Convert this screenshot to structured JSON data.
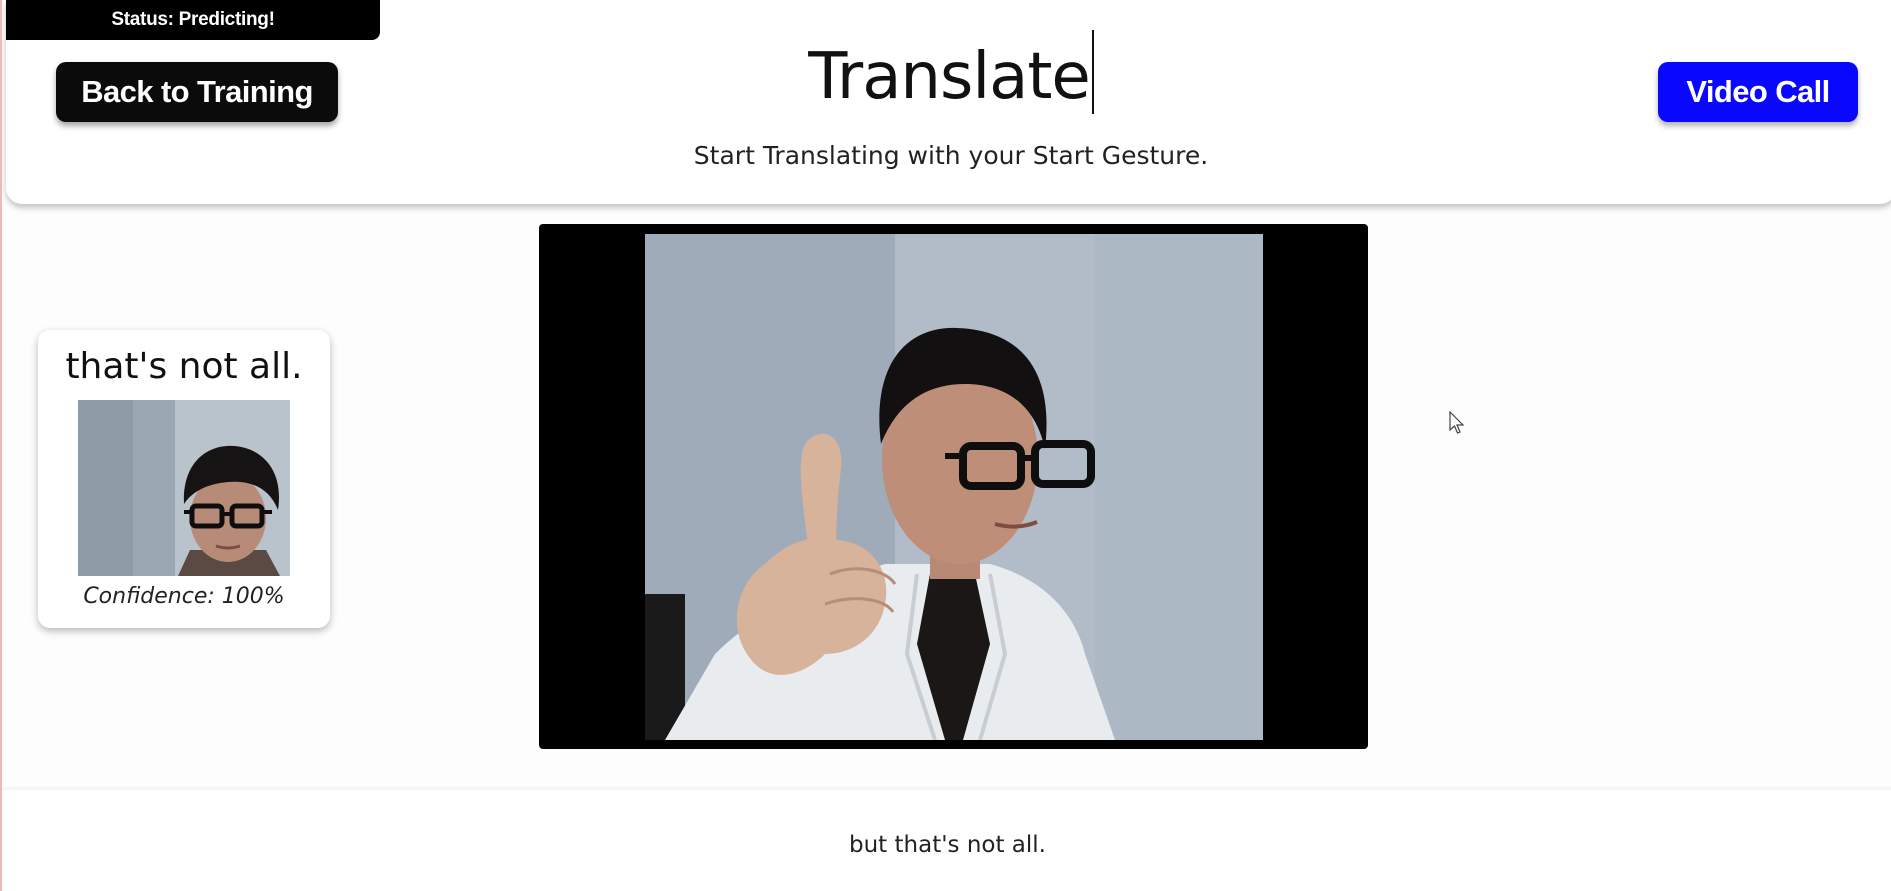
{
  "header": {
    "status_text": "Status: Predicting!",
    "back_button_label": "Back to Training",
    "title": "Translate",
    "subtitle": "Start Translating with your Start Gesture.",
    "video_call_button_label": "Video Call"
  },
  "prediction": {
    "label": "that's not all.",
    "confidence_text": "Confidence: 100%"
  },
  "transcript": {
    "text": "but that's not all."
  },
  "colors": {
    "video_call_button": "#0a07ff",
    "back_button": "#0b0b0b",
    "status_bar": "#000000"
  }
}
